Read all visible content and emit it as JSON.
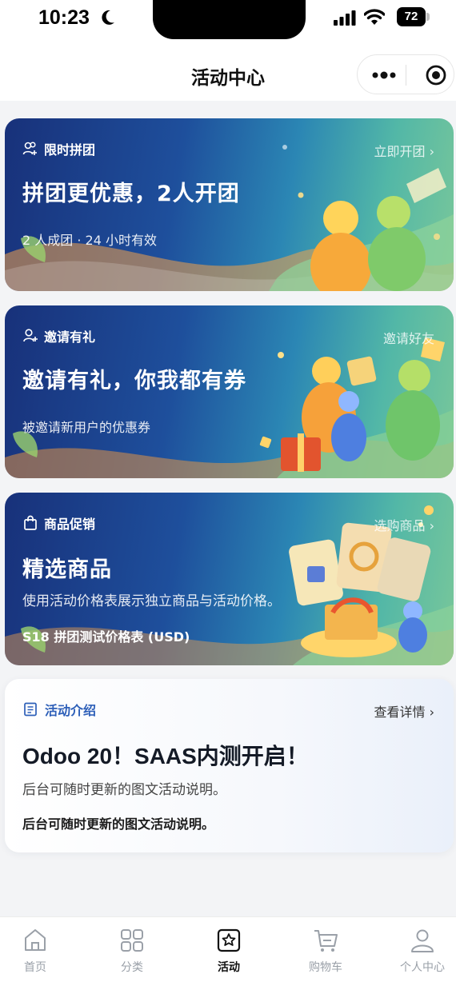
{
  "status_bar": {
    "time": "10:23",
    "battery": "72"
  },
  "nav": {
    "title": "活动中心"
  },
  "banners": [
    {
      "tag": "限时拼团",
      "action": "立即开团",
      "title": "拼团更优惠，2人开团",
      "subtitle": "2 人成团 · 24 小时有效"
    },
    {
      "tag": "邀请有礼",
      "action": "邀请好友",
      "title": "邀请有礼，你我都有券",
      "subtitle": "被邀请新用户的优惠券"
    },
    {
      "tag": "商品促销",
      "action": "选购商品",
      "title": "精选商品",
      "subtitle": "使用活动价格表展示独立商品与活动价格。",
      "extra": "S18 拼团测试价格表 (USD)"
    }
  ],
  "intro": {
    "tag": "活动介绍",
    "action": "查看详情",
    "title": "Odoo 20！SAAS内测开启！",
    "desc": "后台可随时更新的图文活动说明。",
    "desc_bold": "后台可随时更新的图文活动说明。"
  },
  "tabs": [
    {
      "label": "首页",
      "icon": "home-icon",
      "active": false
    },
    {
      "label": "分类",
      "icon": "grid-icon",
      "active": false
    },
    {
      "label": "活动",
      "icon": "star-badge-icon",
      "active": true
    },
    {
      "label": "购物车",
      "icon": "cart-icon",
      "active": false
    },
    {
      "label": "个人中心",
      "icon": "user-icon",
      "active": false
    }
  ]
}
